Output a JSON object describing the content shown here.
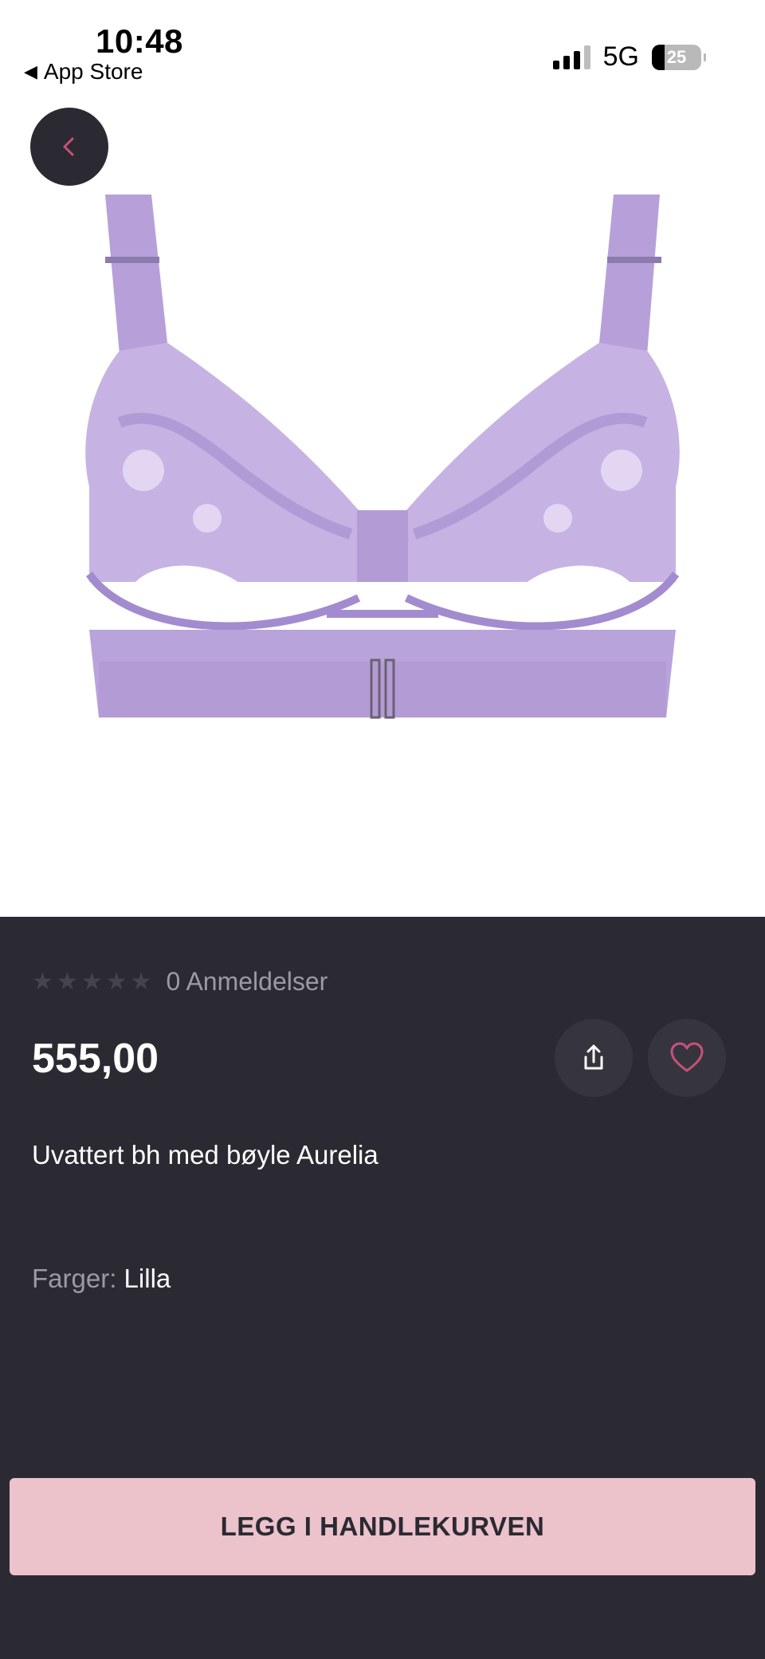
{
  "status_bar": {
    "time": "10:48",
    "back_app": "App Store",
    "network": "5G",
    "battery": "25"
  },
  "colors": {
    "panel_bg": "#2b2a33",
    "accent_pink": "#ecc2cb",
    "heart_pink": "#c8507a",
    "product_lilac": "#b39bd6"
  },
  "product": {
    "rating_count_label": "0 Anmeldelser",
    "stars_filled": 0,
    "stars_total": 5,
    "price": "555,00",
    "title": "Uvattert bh med bøyle Aurelia",
    "colors_label": "Farger:",
    "color_value": "Lilla"
  },
  "actions": {
    "add_to_cart": "LEGG I HANDLEKURVEN",
    "back_icon": "chevron-left-icon",
    "share_icon": "share-icon",
    "wishlist_icon": "heart-icon"
  }
}
